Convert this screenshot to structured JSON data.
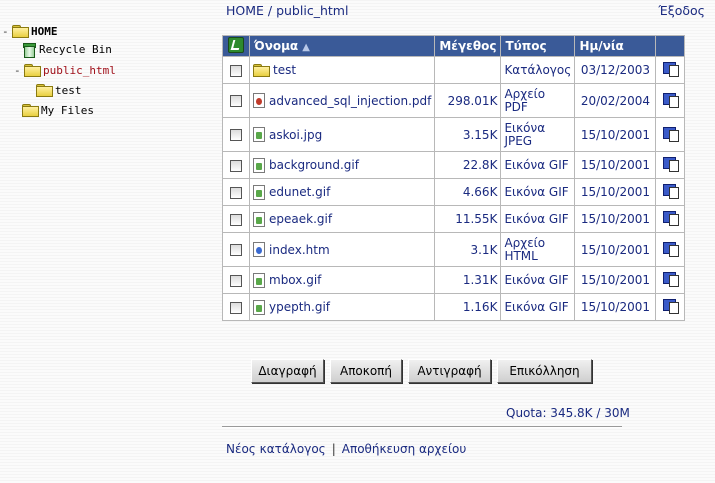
{
  "tree": {
    "home": {
      "toggle": "-",
      "label": "HOME"
    },
    "recycle": {
      "label": "Recycle Bin"
    },
    "public_html": {
      "toggle": "-",
      "label": "public_html"
    },
    "test": {
      "label": "test"
    },
    "myfiles": {
      "label": "My Files"
    }
  },
  "header": {
    "breadcrumb": "HOME / public_html",
    "logout": "Έξοδος"
  },
  "table": {
    "headers": {
      "name": "Όνομα",
      "size": "Μέγεθος",
      "type": "Τύπος",
      "date": "Ημ/νία"
    },
    "rows": [
      {
        "name": "test",
        "size": "",
        "type": [
          "Κατάλογος"
        ],
        "date": "03/12/2003",
        "icon": "folder-icon"
      },
      {
        "name": "advanced_sql_injection.pdf",
        "size": "298.01K",
        "type": [
          "Αρχείο",
          "PDF"
        ],
        "date": "20/02/2004",
        "icon": "pdf-file-icon"
      },
      {
        "name": "askoi.jpg",
        "size": "3.15K",
        "type": [
          "Εικόνα",
          "JPEG"
        ],
        "date": "15/10/2001",
        "icon": "image-file-icon"
      },
      {
        "name": "background.gif",
        "size": "22.8K",
        "type": [
          "Εικόνα GIF"
        ],
        "date": "15/10/2001",
        "icon": "image-file-icon"
      },
      {
        "name": "edunet.gif",
        "size": "4.66K",
        "type": [
          "Εικόνα GIF"
        ],
        "date": "15/10/2001",
        "icon": "image-file-icon"
      },
      {
        "name": "epeaek.gif",
        "size": "11.55K",
        "type": [
          "Εικόνα GIF"
        ],
        "date": "15/10/2001",
        "icon": "image-file-icon"
      },
      {
        "name": "index.htm",
        "size": "3.1K",
        "type": [
          "Αρχείο",
          "HTML"
        ],
        "date": "15/10/2001",
        "icon": "html-file-icon"
      },
      {
        "name": "mbox.gif",
        "size": "1.31K",
        "type": [
          "Εικόνα GIF"
        ],
        "date": "15/10/2001",
        "icon": "image-file-icon"
      },
      {
        "name": "ypepth.gif",
        "size": "1.16K",
        "type": [
          "Εικόνα GIF"
        ],
        "date": "15/10/2001",
        "icon": "image-file-icon"
      }
    ]
  },
  "buttons": {
    "delete": "Διαγραφή",
    "cut": "Αποκοπή",
    "copy": "Αντιγραφή",
    "paste": "Επικόλληση"
  },
  "quota": "Quota: 345.8K / 30M",
  "links": {
    "new_folder": "Νέος κατάλογος",
    "separator": "|",
    "upload": "Αποθήκευση αρχείου"
  },
  "colors": {
    "header_bg": "#3a5a98",
    "link_text": "#1a2a80",
    "tree_active": "#a0101a"
  }
}
